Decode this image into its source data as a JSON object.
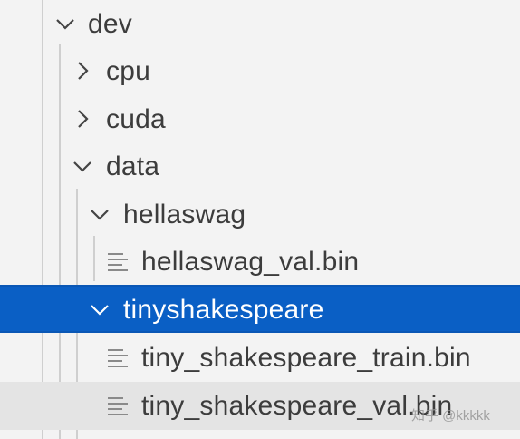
{
  "tree": {
    "dev": {
      "label": "dev",
      "icon": "chevron-down-icon"
    },
    "cpu": {
      "label": "cpu",
      "icon": "chevron-right-icon"
    },
    "cuda": {
      "label": "cuda",
      "icon": "chevron-right-icon"
    },
    "data": {
      "label": "data",
      "icon": "chevron-down-icon"
    },
    "hellaswag": {
      "label": "hellaswag",
      "icon": "chevron-down-icon"
    },
    "hellaswag_val": {
      "label": "hellaswag_val.bin",
      "icon": "file-lines-icon"
    },
    "tinyshakespeare": {
      "label": "tinyshakespeare",
      "icon": "chevron-down-icon",
      "selected": true
    },
    "tiny_train": {
      "label": "tiny_shakespeare_train.bin",
      "icon": "file-lines-icon"
    },
    "tiny_val": {
      "label": "tiny_shakespeare_val.bin",
      "icon": "file-lines-icon",
      "hovered": true
    }
  },
  "watermark": "知乎 @kkkkk",
  "colors": {
    "selection": "#0a5fc5",
    "hover": "#e4e4e4",
    "background": "#f3f3f3",
    "text": "#3c3c3c"
  }
}
